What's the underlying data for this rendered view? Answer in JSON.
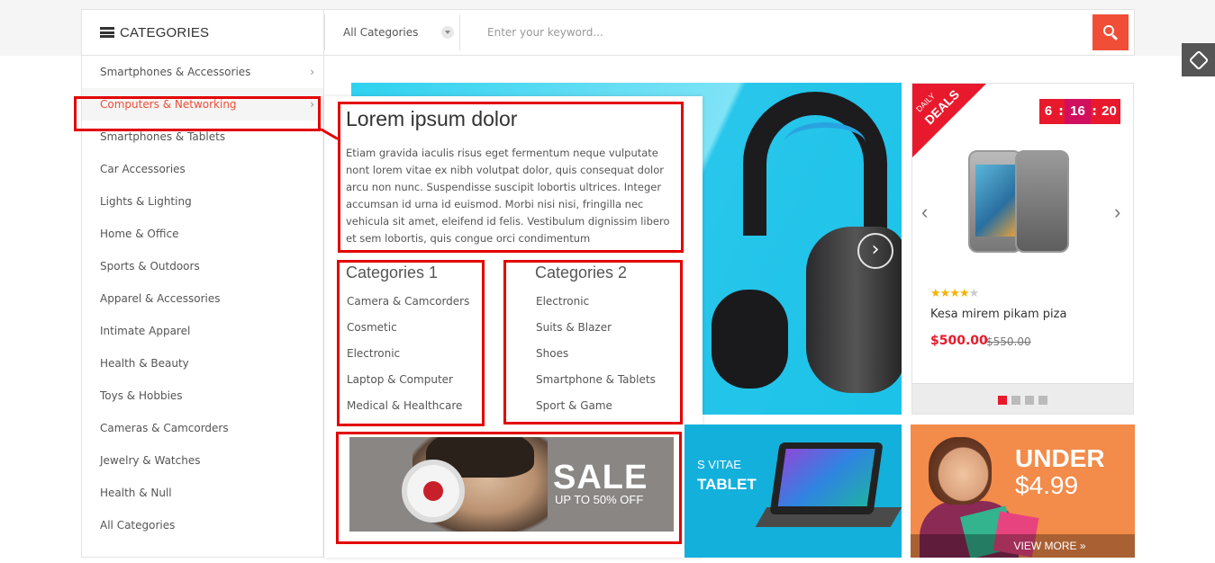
{
  "header": {
    "categories_title": "CATEGORIES",
    "search_category": "All Categories",
    "search_placeholder": "Enter your keyword..."
  },
  "sidebar": {
    "items": [
      {
        "label": "Smartphones & Accessories",
        "chevron": "›"
      },
      {
        "label": "Computers & Networking",
        "chevron": "›"
      },
      {
        "label": "Smartphones & Tablets"
      },
      {
        "label": "Car Accessories"
      },
      {
        "label": "Lights & Lighting"
      },
      {
        "label": "Home & Office"
      },
      {
        "label": "Sports & Outdoors"
      },
      {
        "label": "Apparel & Accessories"
      },
      {
        "label": "Intimate Apparel"
      },
      {
        "label": "Health & Beauty"
      },
      {
        "label": "Toys & Hobbies"
      },
      {
        "label": "Cameras & Camcorders"
      },
      {
        "label": "Jewelry & Watches"
      },
      {
        "label": "Health & Null"
      },
      {
        "label": "All Categories"
      }
    ],
    "active_index": 1
  },
  "mega": {
    "title": "Lorem ipsum dolor",
    "description": "Etiam gravida iaculis risus eget fermentum neque vulputate nont lorem vitae ex nibh volutpat dolor, quis consequat dolor arcu non nunc. Suspendisse suscipit lobortis ultrices. Integer accumsan id urna id euismod. Morbi nisi nisi, fringilla nec vehicula sit amet, eleifend id felis. Vestibulum dignissim libero et sem lobortis, quis congue orci condimentum",
    "col1": {
      "title": "Categories 1",
      "items": [
        "Camera & Camcorders",
        "Cosmetic",
        "Electronic",
        "Laptop & Computer",
        "Medical & Healthcare"
      ]
    },
    "col2": {
      "title": "Categories 2",
      "items": [
        "Electronic",
        "Suits & Blazer",
        "Shoes",
        "Smartphone & Tablets",
        "Sport & Game"
      ]
    },
    "banner": {
      "sale": "SALE",
      "subtitle": "UP TO 50% OFF"
    }
  },
  "deals": {
    "ribbon_small": "DAILY",
    "ribbon_big": "DEALS",
    "timer": [
      "6",
      "16",
      "20"
    ],
    "timer_sep": ":",
    "rating": 4,
    "rating_max": 5,
    "product_name": "Kesa mirem pikam piza",
    "price": "$500.00",
    "old_price": "$550.00",
    "dots": 4,
    "active_dot": 0,
    "prev": "‹",
    "next": "›"
  },
  "banners": {
    "tablet_line1": "S VITAE",
    "tablet_line2": "TABLET",
    "under_line1": "UNDER",
    "under_line2": "$4.99",
    "view_more": "VIEW MORE »"
  },
  "colors": {
    "accent": "#f04e36",
    "highlight": "#e30000",
    "deal_red": "#e8192c"
  }
}
